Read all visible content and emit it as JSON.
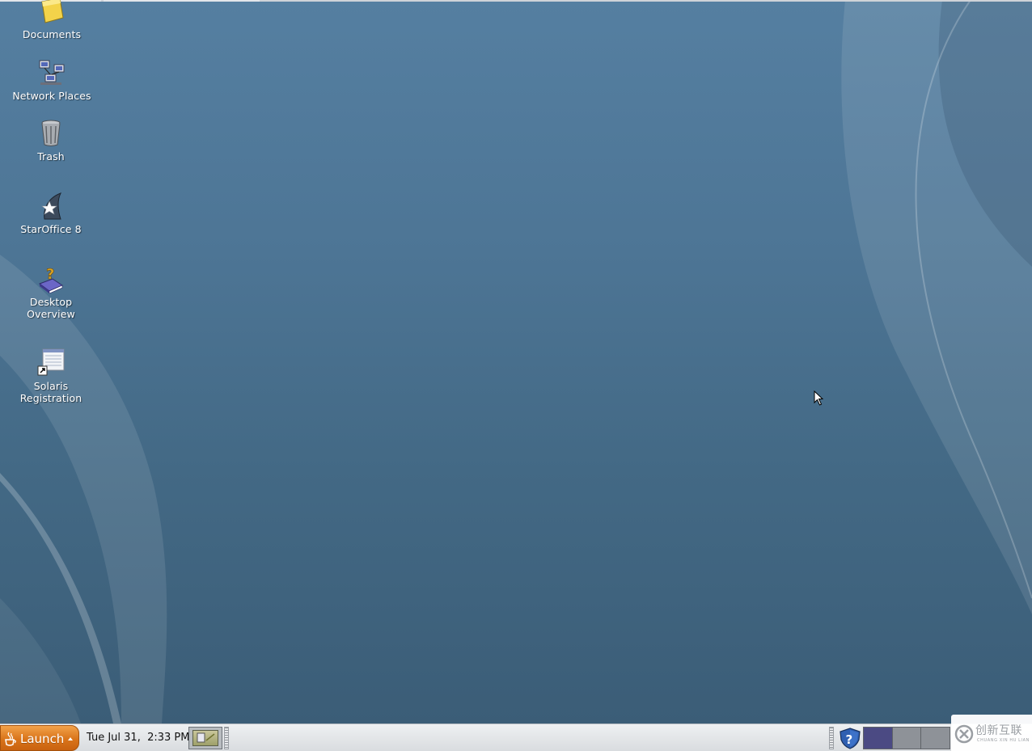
{
  "desktop": {
    "background_color": "#4a7090",
    "icons": [
      {
        "label": "Documents",
        "icon": "folder-icon"
      },
      {
        "label": "Network Places",
        "icon": "network-icon"
      },
      {
        "label": "Trash",
        "icon": "trash-icon"
      },
      {
        "label": "StarOffice 8",
        "icon": "staroffice-icon"
      },
      {
        "label_line1": "Desktop",
        "label_line2": "Overview",
        "icon": "help-book-icon"
      },
      {
        "label_line1": "Solaris",
        "label_line2": "Registration",
        "icon": "registration-shortcut-icon"
      }
    ]
  },
  "taskbar": {
    "launch_label": "Launch",
    "launch_color": "#d9741a",
    "clock": "Tue Jul 31,  2:33 PM",
    "show_desktop_icon": "show-desktop-icon",
    "help_icon": "help-shield-icon",
    "workspaces": [
      {
        "active": true,
        "color": "#4b4a83"
      },
      {
        "active": false,
        "color": "#8e9298"
      },
      {
        "active": false,
        "color": "#8e9298"
      }
    ]
  },
  "watermark": {
    "text_cn": "创新互联",
    "text_en": "CHUANG XIN HU LIAN"
  }
}
